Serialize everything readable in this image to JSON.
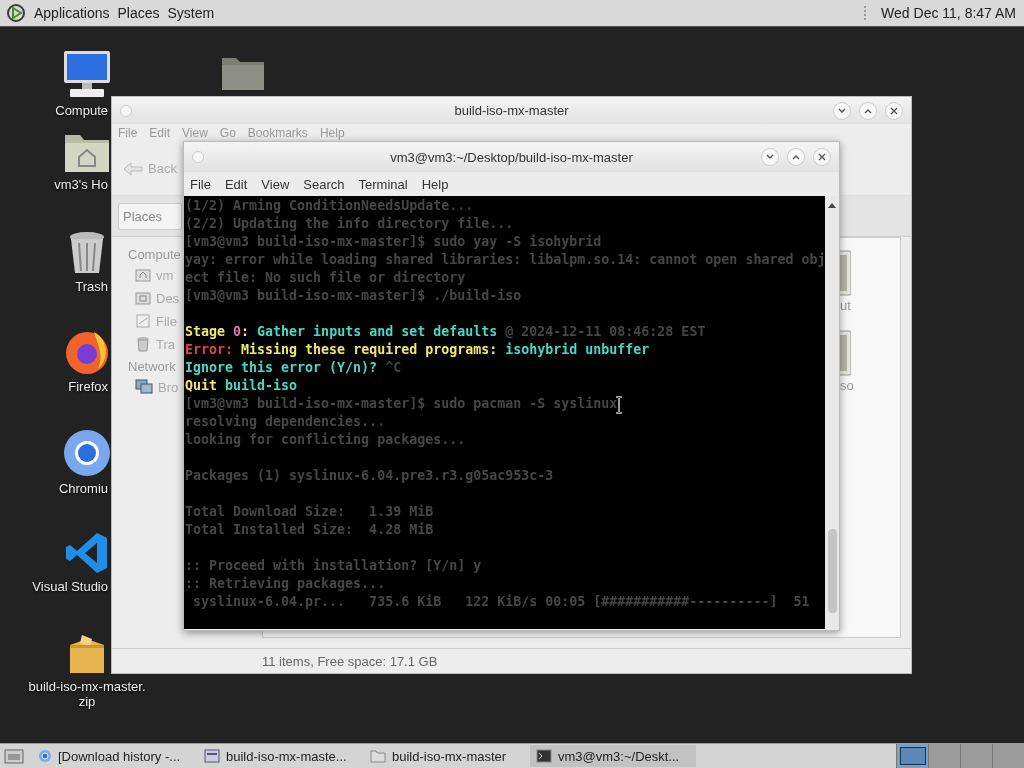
{
  "top_panel": {
    "menus": [
      "Applications",
      "Places",
      "System"
    ],
    "clock": "Wed Dec 11, 8:47 AM"
  },
  "desktop_icons": [
    {
      "kind": "computer",
      "label": "Compute"
    },
    {
      "kind": "home",
      "label": "vm3's Ho"
    },
    {
      "kind": "trash",
      "label": "Trash"
    },
    {
      "kind": "firefox",
      "label": "Firefox"
    },
    {
      "kind": "chromium",
      "label": "Chromiu"
    },
    {
      "kind": "editor",
      "label": "Visual Studio"
    },
    {
      "kind": "archive",
      "label": "build-iso-mx-master.\nzip"
    },
    {
      "kind": "folder"
    }
  ],
  "file_manager": {
    "title": "build-iso-mx-master",
    "menu": [
      "File",
      "Edit",
      "View",
      "Go",
      "Bookmarks",
      "Help"
    ],
    "back_button": "Back",
    "location_dropdown": "Places",
    "sidebar": [
      {
        "heading": "Compute",
        "items": [
          {
            "kind": "home",
            "label": "vm"
          },
          {
            "kind": "desktop",
            "label": "Des"
          },
          {
            "kind": "filesystem",
            "label": "File"
          },
          {
            "kind": "trash",
            "label": "Tra"
          }
        ]
      },
      {
        "heading": "Network",
        "items": [
          {
            "kind": "network",
            "label": "Bro"
          }
        ]
      }
    ],
    "files": [
      "ut",
      "so"
    ],
    "status_bar": "11 items, Free space: 17.1 GB"
  },
  "terminal": {
    "title": "vm3@vm3:~/Desktop/build-iso-mx-master",
    "menu": [
      "File",
      "Edit",
      "View",
      "Search",
      "Terminal",
      "Help"
    ],
    "lines": [
      {
        "kind": "text",
        "segments": [
          {
            "text": "(1/2) Arming ConditionNeedsUpdate...",
            "color": "#464646"
          }
        ]
      },
      {
        "kind": "text",
        "segments": [
          {
            "text": "(2/2) Updating the info directory file...",
            "color": "#464646"
          }
        ]
      },
      {
        "kind": "text",
        "segments": [
          {
            "text": "[vm3@vm3 build-iso-mx-master]$ sudo yay -S isohybrid",
            "color": "#464646"
          }
        ]
      },
      {
        "kind": "text",
        "segments": [
          {
            "text": "yay: error while loading shared libraries: libalpm.so.14: cannot open shared obj",
            "color": "#464646"
          }
        ]
      },
      {
        "kind": "text",
        "segments": [
          {
            "text": "ect file: No such file or directory",
            "color": "#464646"
          }
        ]
      },
      {
        "kind": "text",
        "segments": [
          {
            "text": "[vm3@vm3 build-iso-mx-master]$ ./build-iso",
            "color": "#464646"
          }
        ]
      },
      {
        "kind": "blank"
      },
      {
        "kind": "text",
        "segments": [
          {
            "text": "Stage ",
            "color": "#f2e86a"
          },
          {
            "text": "0",
            "color": "#d878a8"
          },
          {
            "text": ": ",
            "color": "#f2e86a"
          },
          {
            "text": "Gather inputs and set defaults",
            "color": "#48d8c8"
          },
          {
            "text": " @ 2024-12-11 08:46:28 EST",
            "color": "#464646"
          }
        ]
      },
      {
        "kind": "text",
        "segments": [
          {
            "text": "Error:",
            "color": "#d84848"
          },
          {
            "text": " Missing these required programs: ",
            "color": "#f2e86a"
          },
          {
            "text": "isohybrid unbuffer",
            "color": "#48d8c8"
          }
        ]
      },
      {
        "kind": "text",
        "segments": [
          {
            "text": "Ignore this error (Y/n)?",
            "color": "#48d8c8"
          },
          {
            "text": " ^C",
            "color": "#464646"
          }
        ]
      },
      {
        "kind": "text",
        "segments": [
          {
            "text": "Quit",
            "color": "#f2e86a"
          },
          {
            "text": " build-iso",
            "color": "#48d8c8"
          }
        ]
      },
      {
        "kind": "text",
        "segments": [
          {
            "text": "[vm3@vm3 build-iso-mx-master]$ sudo pacman -S syslinux",
            "color": "#464646"
          }
        ]
      },
      {
        "kind": "text",
        "segments": [
          {
            "text": "resolving dependencies...",
            "color": "#464646"
          }
        ]
      },
      {
        "kind": "text",
        "segments": [
          {
            "text": "looking for conflicting packages...",
            "color": "#464646"
          }
        ]
      },
      {
        "kind": "blank"
      },
      {
        "kind": "text",
        "segments": [
          {
            "text": "Packages (1) syslinux-6.04.pre3.r3.g05ac953c-3",
            "color": "#464646"
          }
        ]
      },
      {
        "kind": "blank"
      },
      {
        "kind": "text",
        "segments": [
          {
            "text": "Total Download Size:   1.39 MiB",
            "color": "#464646"
          }
        ]
      },
      {
        "kind": "text",
        "segments": [
          {
            "text": "Total Installed Size:  4.28 MiB",
            "color": "#464646"
          }
        ]
      },
      {
        "kind": "blank"
      },
      {
        "kind": "text",
        "segments": [
          {
            "text": ":: Proceed with installation? [Y/n] y",
            "color": "#464646"
          }
        ]
      },
      {
        "kind": "text",
        "segments": [
          {
            "text": ":: Retrieving packages...",
            "color": "#464646"
          }
        ]
      },
      {
        "kind": "text",
        "segments": [
          {
            "text": " syslinux-6.04.pr...   735.6 KiB   122 KiB/s 00:05 [###########----------]  51",
            "color": "#464646"
          }
        ]
      }
    ]
  },
  "taskbar": {
    "items": [
      {
        "kind": "browser",
        "label": "[Download history -...",
        "selected": false
      },
      {
        "kind": "files",
        "label": "build-iso-mx-maste...",
        "selected": false
      },
      {
        "kind": "folder",
        "label": "build-iso-mx-master",
        "selected": false
      },
      {
        "kind": "terminal",
        "label": "vm3@vm3:~/Deskt...",
        "selected": true
      }
    ],
    "workspaces": [
      {
        "selected": true
      },
      {
        "selected": false
      },
      {
        "selected": false
      },
      {
        "selected": false
      }
    ]
  }
}
